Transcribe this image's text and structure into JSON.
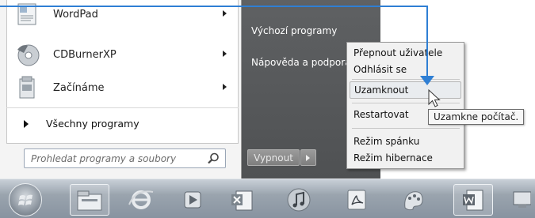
{
  "start_menu": {
    "programs": [
      {
        "label": "WordPad",
        "icon": "wordpad-icon",
        "has_submenu": true
      },
      {
        "label": "CDBurnerXP",
        "icon": "cdburner-icon",
        "has_submenu": true
      },
      {
        "label": "Začínáme",
        "icon": "getting-started-icon",
        "has_submenu": true
      }
    ],
    "all_programs": "Všechny programy",
    "search_placeholder": "Prohledat programy a soubory",
    "right_links": [
      "Výchozí programy",
      "Nápověda a podpora"
    ],
    "shutdown_label": "Vypnout"
  },
  "context_menu": {
    "items": [
      {
        "label": "Přepnout uživatele",
        "highlighted": false
      },
      {
        "label": "Odhlásit se",
        "highlighted": false
      },
      {
        "label": "Uzamknout",
        "highlighted": true
      },
      {
        "label": "Restartovat",
        "highlighted": false
      },
      {
        "label": "Režim spánku",
        "highlighted": false
      },
      {
        "label": "Režim hibernace",
        "highlighted": false
      }
    ]
  },
  "tooltip": "Uzamkne počítač.",
  "taskbar": {
    "items": [
      "start-orb-icon",
      "explorer-icon",
      "internet-explorer-icon",
      "media-player-icon",
      "excel-icon",
      "itunes-icon",
      "acrobat-icon",
      "paint-icon",
      "word-icon",
      "network-icon"
    ]
  },
  "colors": {
    "accent_line": "#2f7fd4",
    "menu_right_bg": "#55575a"
  }
}
